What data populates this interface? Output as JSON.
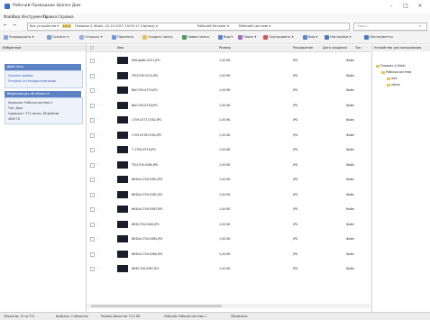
{
  "window": {
    "title": "Рабочий Проводник Шапке Дом",
    "minimize": "–",
    "maximize": "□",
    "close": "×"
  },
  "menu": [
    "Файл",
    "Вид",
    "Инструменты",
    "Правка",
    "Справка"
  ],
  "address": {
    "root": "Все устройства ▾",
    "highlight": "LO.3",
    "crumbs": [
      "Плеерах 4 (Ktok): 31.10.2017 19:05:17 (Optima) ▾",
      "Рабочий Каталог ▾",
      "Рабочий система ▾"
    ],
    "search_placeholder": "Поиск..."
  },
  "toolbar": {
    "items": [
      {
        "label": "Упорядочить ▾",
        "color": "#8aa7d6"
      },
      {
        "label": "Скачать ▾",
        "color": "#7a9bd0"
      },
      {
        "label": "Открыть ▾",
        "color": "#9bb1d9"
      },
      {
        "label": "Просмотр",
        "color": "#6e9be0"
      },
      {
        "label": "Создать папку",
        "color": "#e6c25c"
      },
      {
        "label": "Новая папка",
        "color": "#4c9a5a"
      },
      {
        "label": "Вид ▾",
        "color": "#5a86c8"
      },
      {
        "label": "Поиск ▾",
        "color": "#a06bc2"
      },
      {
        "label": "Сортировать ▾",
        "color": "#c85a5a"
      },
      {
        "label": "Вид ▾",
        "color": "#5a86c8"
      },
      {
        "label": "Настройки ▾",
        "color": "#4a7bc0"
      },
      {
        "label": "Инструменты",
        "color": "#4a7bc0"
      }
    ]
  },
  "left_panel": {
    "header": "Избранное",
    "tasks_panel": {
      "title": "Действия",
      "items": [
        "Скачать файлы",
        "Открыть в стандартном виде"
      ]
    },
    "details_panel": {
      "title": "Информация об объекте",
      "lines": [
        "Название: Рабочая система 1",
        "Тип: Диск",
        "Содержит: 372 папки, 48 файлов",
        "4000 ГБ"
      ]
    }
  },
  "file_list": {
    "columns": [
      "Имя",
      "Размер",
      "Расширение",
      "Дата создания",
      "Тип"
    ],
    "rows": [
      {
        "name": "IMG-файл-0311.JPG",
        "size": "1,00 КБ",
        "ext": "JPG",
        "src": "Файл"
      },
      {
        "name": "ТЮ1709-0374.JPG",
        "size": "1,00 КБ",
        "ext": "JPG",
        "src": "Файл"
      },
      {
        "name": "ВЫ1709-0375.JPG",
        "size": "1,00 КБ",
        "ext": "JPG",
        "src": "Файл"
      },
      {
        "name": "ВЫ1709-0376.JPG",
        "size": "1,00 КБ",
        "ext": "JPG",
        "src": "Файл"
      },
      {
        "name": "1709-0377-0782.JPG",
        "size": "1,00 КБ",
        "ext": "JPG",
        "src": "Файл"
      },
      {
        "name": "1709-0378-0783.JPG",
        "size": "1,00 КБ",
        "ext": "JPG",
        "src": "Файл"
      },
      {
        "name": "Т-1709-0379.JPG",
        "size": "1,00 КБ",
        "ext": "JPG",
        "src": "Файл"
      },
      {
        "name": "ТЮ1709-0380.JPG",
        "size": "1,00 КБ",
        "ext": "JPG",
        "src": "Файл"
      },
      {
        "name": "ИКБ0с1709-0381.JPG",
        "size": "1,00 КБ",
        "ext": "JPG",
        "src": "Файл"
      },
      {
        "name": "ИКБ0с1709-0382.JPG",
        "size": "1,00 КБ",
        "ext": "JPG",
        "src": "Файл"
      },
      {
        "name": "ИКБ0с1709-0383.JPG",
        "size": "1,00 КБ",
        "ext": "JPG",
        "src": "Файл"
      },
      {
        "name": "ИКБ1709-0384.JPG",
        "size": "1,00 КБ",
        "ext": "JPG",
        "src": "Файл"
      },
      {
        "name": "ИКБ0с1709-0385.JPG",
        "size": "1,00 КБ",
        "ext": "JPG",
        "src": "Файл"
      },
      {
        "name": "ИКБ0с1709-0386.JPG",
        "size": "1,00 КБ",
        "ext": "JPG",
        "src": "Файл"
      },
      {
        "name": "ИКБ1709-0387.JPG",
        "size": "1,00 КБ",
        "ext": "JPG",
        "src": "Файл"
      }
    ]
  },
  "right_panel": {
    "header": "Устройство для копирования",
    "tree": [
      "Плеерах 4 (Ktok)",
      "Рабочая система",
      "disk",
      "album"
    ]
  },
  "status": {
    "items": [
      "Объектов: 15 из 372",
      "Выбрано: 0 объектов",
      "Размер объектов: 15,0 КБ",
      "Рабочий: Рабочая система 1",
      "Обновлено"
    ]
  }
}
